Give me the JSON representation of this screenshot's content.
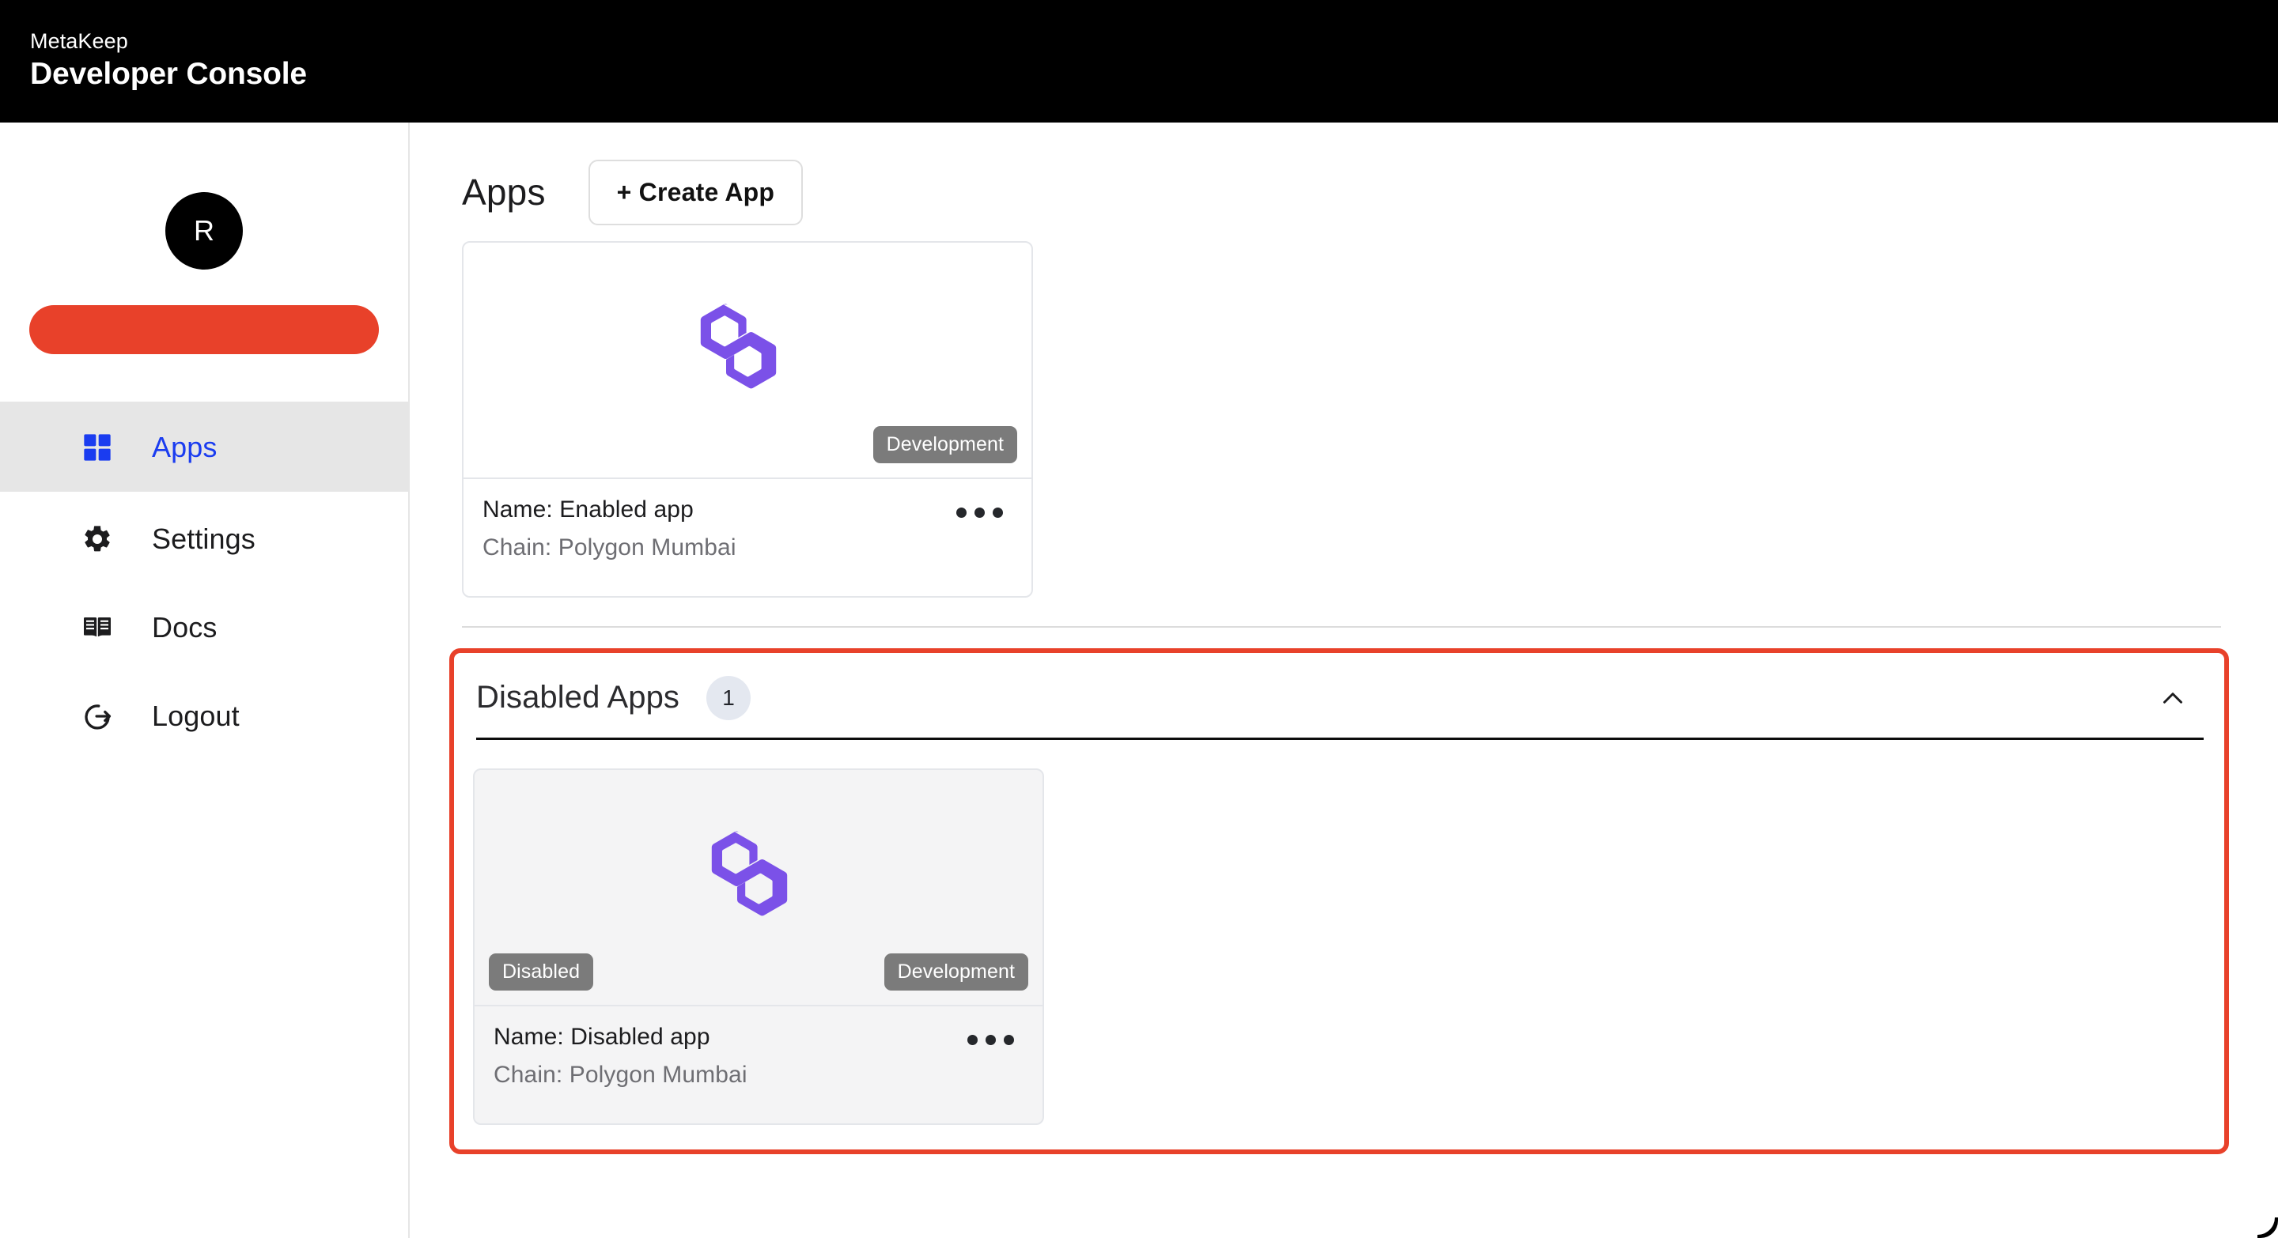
{
  "header": {
    "brand": "MetaKeep",
    "product": "Developer Console"
  },
  "sidebar": {
    "avatar_initial": "R",
    "redacted_account_bar": "",
    "items": [
      {
        "label": "Apps",
        "icon": "grid-icon",
        "active": true
      },
      {
        "label": "Settings",
        "icon": "gear-icon",
        "active": false
      },
      {
        "label": "Docs",
        "icon": "book-icon",
        "active": false
      },
      {
        "label": "Logout",
        "icon": "logout-icon",
        "active": false
      }
    ]
  },
  "main": {
    "page_title": "Apps",
    "create_button_label": "+ Create App",
    "enabled_apps": [
      {
        "name_label": "Name: Enabled app",
        "chain_label": "Chain: Polygon Mumbai",
        "env_badge": "Development",
        "logo": "polygon-logo",
        "menu_icon": "kebab-menu-icon"
      }
    ],
    "disabled_section": {
      "title": "Disabled Apps",
      "count": "1",
      "collapse_icon": "chevron-up-icon",
      "expanded": true,
      "apps": [
        {
          "name_label": "Name: Disabled app",
          "chain_label": "Chain: Polygon Mumbai",
          "state_badge": "Disabled",
          "env_badge": "Development",
          "logo": "polygon-logo",
          "menu_icon": "kebab-menu-icon"
        }
      ]
    }
  },
  "colors": {
    "accent_red": "#e8412a",
    "active_blue": "#1a3cf0",
    "badge_gray": "#7b7b7b",
    "polygon_purple": "#7b51e8",
    "header_black": "#000000"
  }
}
